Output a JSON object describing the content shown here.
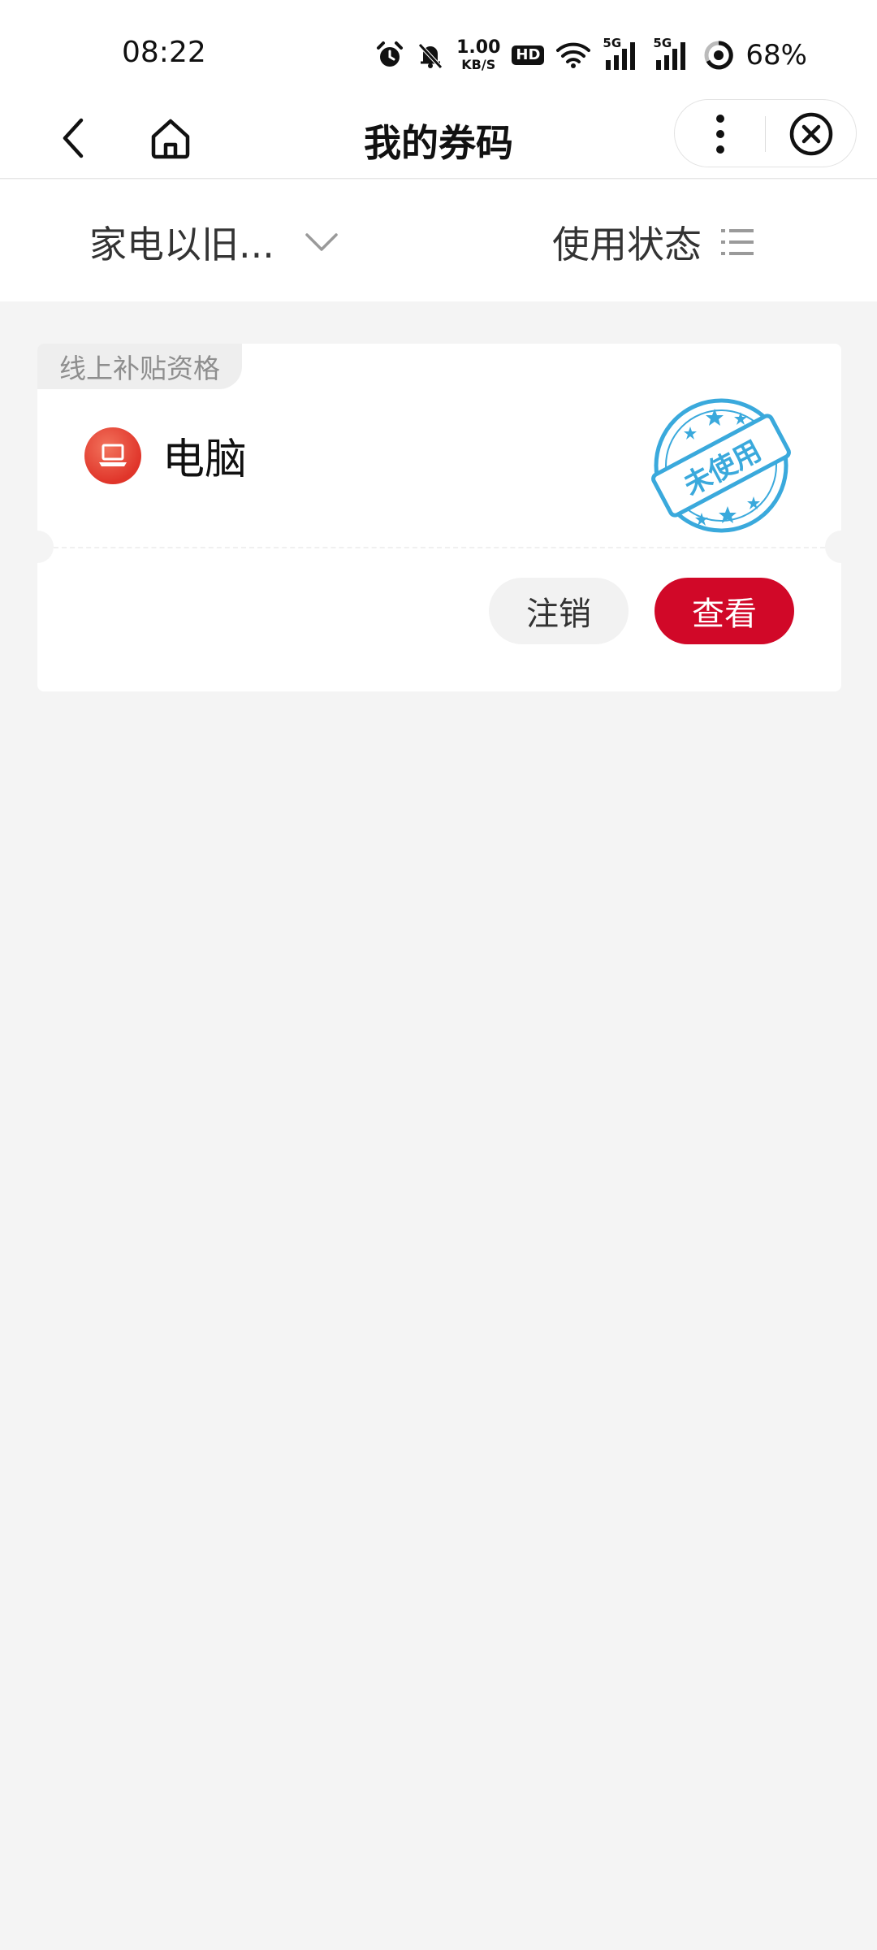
{
  "status_bar": {
    "time": "08:22",
    "net_speed_value": "1.00",
    "net_speed_unit": "KB/S",
    "hd_label": "HD",
    "signal_1_label": "5G",
    "signal_2_label": "5G",
    "battery": "68%",
    "icons": [
      "alarm-icon",
      "bell-muted-icon",
      "wifi-icon",
      "signal-icon",
      "battery-ring-icon"
    ]
  },
  "nav": {
    "title": "我的券码",
    "icons": [
      "back-arrow-icon",
      "home-icon",
      "more-vertical-icon",
      "close-circle-icon"
    ]
  },
  "filters": {
    "category_label": "家电以旧...",
    "status_label": "使用状态",
    "icons": [
      "chevron-down-icon",
      "list-icon"
    ]
  },
  "coupon": {
    "tag": "线上补贴资格",
    "product_name": "电脑",
    "product_icon": "laptop-icon",
    "status_stamp": "未使用",
    "buttons": {
      "cancel": "注销",
      "view": "查看"
    }
  },
  "colors": {
    "accent_red": "#d10828",
    "stamp_blue": "#3aa9dc",
    "background": "#f4f4f4"
  }
}
